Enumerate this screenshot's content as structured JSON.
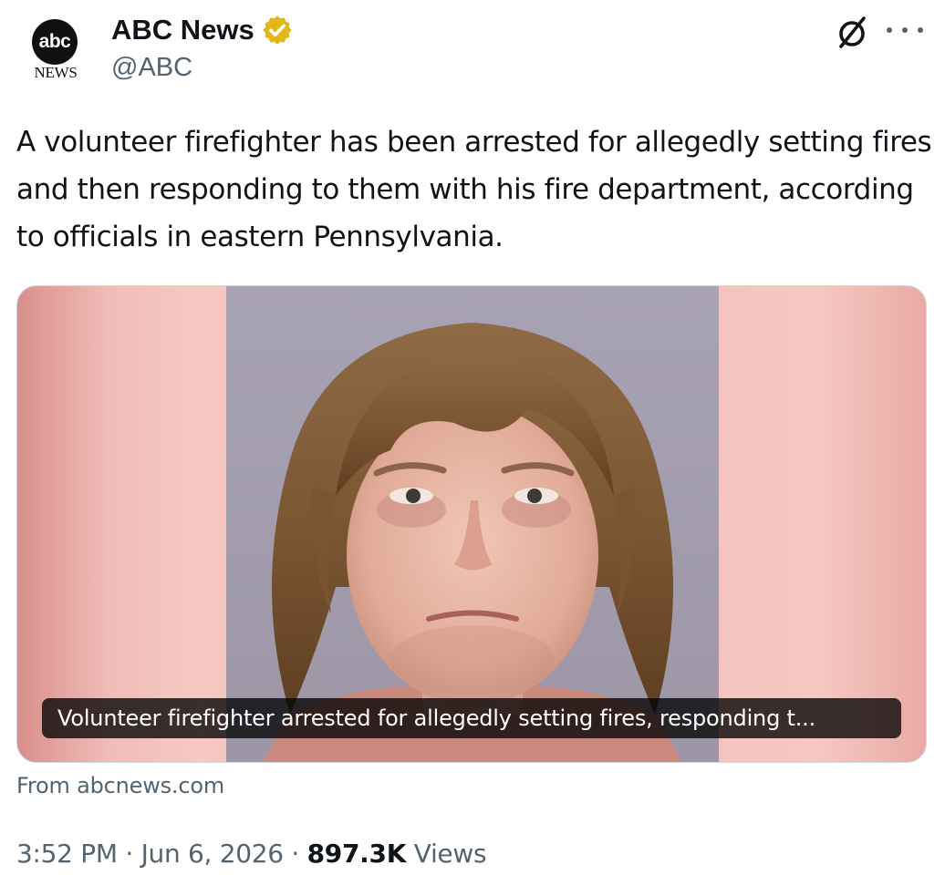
{
  "author": {
    "display_name": "ABC News",
    "handle": "@ABC",
    "verified": true,
    "verified_color": "#e2b719",
    "avatar": {
      "logo_text": "abc",
      "logo_subtext": "NEWS"
    }
  },
  "header": {
    "grok_icon": "grok-slash-circle-icon",
    "more_icon": "more-dots-icon"
  },
  "tweet": {
    "text": "A volunteer firefighter has been arrested for allegedly setting fires and then responding to them with his fire department, according to officials in eastern Pennsylvania."
  },
  "card": {
    "caption": "Volunteer firefighter arrested for allegedly setting fires, responding t...",
    "source": "From abcnews.com"
  },
  "meta": {
    "time": "3:52 PM",
    "separator": "·",
    "date": "Jun 6, 2026",
    "views_count": "897.3K",
    "views_label": "Views"
  },
  "colors": {
    "text_primary": "#0f1419",
    "text_secondary": "#536471",
    "card_border": "#cfd9de"
  }
}
